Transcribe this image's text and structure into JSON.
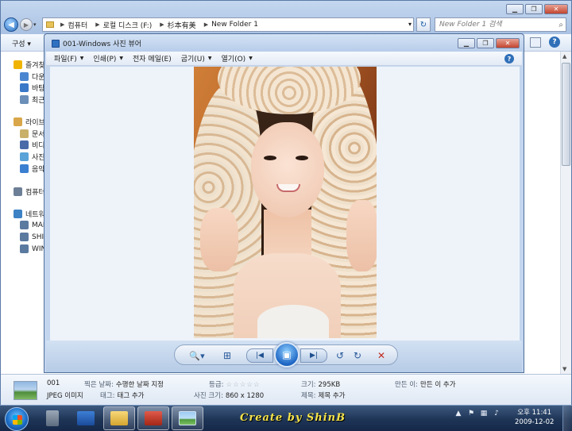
{
  "explorer": {
    "breadcrumbs": [
      "컴퓨터",
      "로컬 디스크 (F:)",
      "杉本有美",
      "New Folder 1"
    ],
    "search_placeholder": "New Folder 1 검색",
    "organize_label": "구성 ▾",
    "help_glyph": "?",
    "nav_items": [
      {
        "label": "즐겨찾기",
        "icon": "star-icon",
        "color": "#f0b400"
      },
      {
        "label": "다운로드",
        "icon": "download-folder-icon",
        "color": "#4a86d0"
      },
      {
        "label": "바탕 화면",
        "icon": "desktop-icon",
        "color": "#3a78c8"
      },
      {
        "label": "최근 위치",
        "icon": "recent-places-icon",
        "color": "#6b8fb8"
      },
      {
        "label": "라이브러리",
        "icon": "library-icon",
        "color": "#d9a64a"
      },
      {
        "label": "문서",
        "icon": "documents-icon",
        "color": "#c9b06a"
      },
      {
        "label": "비디오",
        "icon": "videos-icon",
        "color": "#4a6aa8"
      },
      {
        "label": "사진",
        "icon": "pictures-icon",
        "color": "#5aa3d8"
      },
      {
        "label": "음악",
        "icon": "music-icon",
        "color": "#3b7fd0"
      },
      {
        "label": "컴퓨터",
        "icon": "computer-icon",
        "color": "#6d7f96"
      },
      {
        "label": "네트워크",
        "icon": "network-icon",
        "color": "#3d82c4"
      },
      {
        "label": "MAIN",
        "icon": "pc-icon",
        "color": "#5b7aa0"
      },
      {
        "label": "SHIN",
        "icon": "pc-icon",
        "color": "#5b7aa0"
      },
      {
        "label": "WIN-",
        "icon": "pc-icon",
        "color": "#5b7aa0"
      }
    ]
  },
  "viewer": {
    "title": "001-Windows 사진 뷰어",
    "menu": [
      "파일(F)",
      "인쇄(P)",
      "전자 메일(E)",
      "굽기(U)",
      "열기(O)"
    ],
    "help_glyph": "?",
    "controls": {
      "zoom": "🔍▾",
      "fit": "⊞",
      "prev": "|◀",
      "slideshow": "▣",
      "next": "▶|",
      "rotate_left": "↺",
      "rotate_right": "↻",
      "delete": "✕"
    }
  },
  "details": {
    "filename": "001",
    "filetype": "JPEG 이미지",
    "date_taken_key": "찍은 날짜:",
    "date_taken_val": "수행한 날짜 지정",
    "tags_key": "태그:",
    "tags_val": "태그 추가",
    "rating_key": "등급:",
    "rating_stars": "☆☆☆☆☆",
    "dimensions_key": "사진 크기:",
    "dimensions_val": "860 x 1280",
    "size_key": "크기:",
    "size_val": "295KB",
    "title_key": "제목:",
    "title_val": "제목 추가",
    "author_key": "만든 이:",
    "author_val": "만든 이 추가"
  },
  "taskbar": {
    "brand": "Create by ShinB",
    "clock_period": "오후 11:41",
    "clock_date": "2009-12-02",
    "tray_arrow": "▲"
  },
  "colors": {
    "accent": "#2f6fb8",
    "taskbar": "#1e3556",
    "brand_text": "#f5e34a"
  }
}
